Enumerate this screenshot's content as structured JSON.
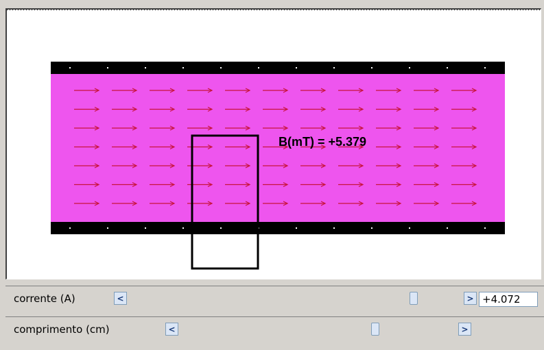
{
  "simulation": {
    "field_label": "B(mT) = +5.379",
    "field_region_color": "#ee55ee",
    "plate_color": "#000000",
    "arrow_color": "#c8143c",
    "loop_color": "#000000",
    "arrow_rows": 7,
    "arrow_columns": 11
  },
  "controls": {
    "current": {
      "label": "corrente (A)",
      "value": "+4.072",
      "slider_fraction": 0.86,
      "left_icon": "arrow-left-icon",
      "right_icon": "arrow-right-icon"
    },
    "length": {
      "label": "comprimento (cm)",
      "slider_fraction": 0.71,
      "left_icon": "arrow-left-icon",
      "right_icon": "arrow-right-icon"
    }
  }
}
